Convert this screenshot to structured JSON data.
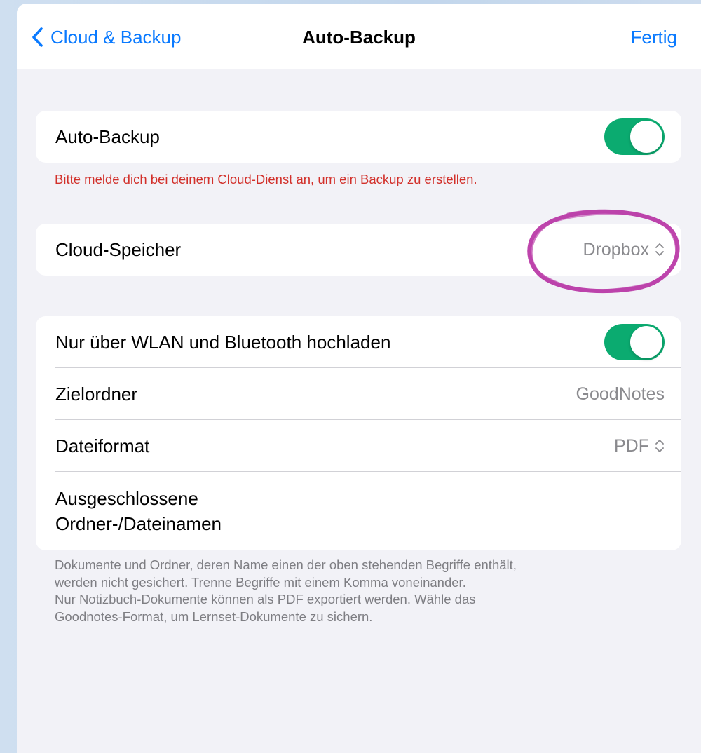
{
  "navbar": {
    "back_label": "Cloud & Backup",
    "title": "Auto-Backup",
    "done_label": "Fertig"
  },
  "auto_backup": {
    "label": "Auto-Backup",
    "enabled": true,
    "error": "Bitte melde dich bei deinem Cloud-Dienst an, um ein Backup zu erstellen."
  },
  "cloud_storage": {
    "label": "Cloud-Speicher",
    "value": "Dropbox"
  },
  "settings": {
    "wifi_only": {
      "label": "Nur über WLAN und Bluetooth hochladen",
      "enabled": true
    },
    "target_folder": {
      "label": "Zielordner",
      "value": "GoodNotes"
    },
    "file_format": {
      "label": "Dateiformat",
      "value": "PDF"
    },
    "excluded_names": {
      "label_line1": "Ausgeschlossene",
      "label_line2": "Ordner-/Dateinamen"
    }
  },
  "footer": {
    "line1": "Dokumente und Ordner, deren Name einen der oben stehenden Begriffe enthält,",
    "line2": "werden nicht gesichert. Trenne Begriffe mit einem Komma voneinander.",
    "line3": "Nur Notizbuch-Dokumente können als PDF exportiert werden. Wähle das",
    "line4": "Goodnotes-Format, um Lernset-Dokumente zu sichern."
  },
  "colors": {
    "accent": "#0a7aff",
    "toggle_on": "#0bab70",
    "error": "#d2302a",
    "annotation": "#b3259e"
  }
}
